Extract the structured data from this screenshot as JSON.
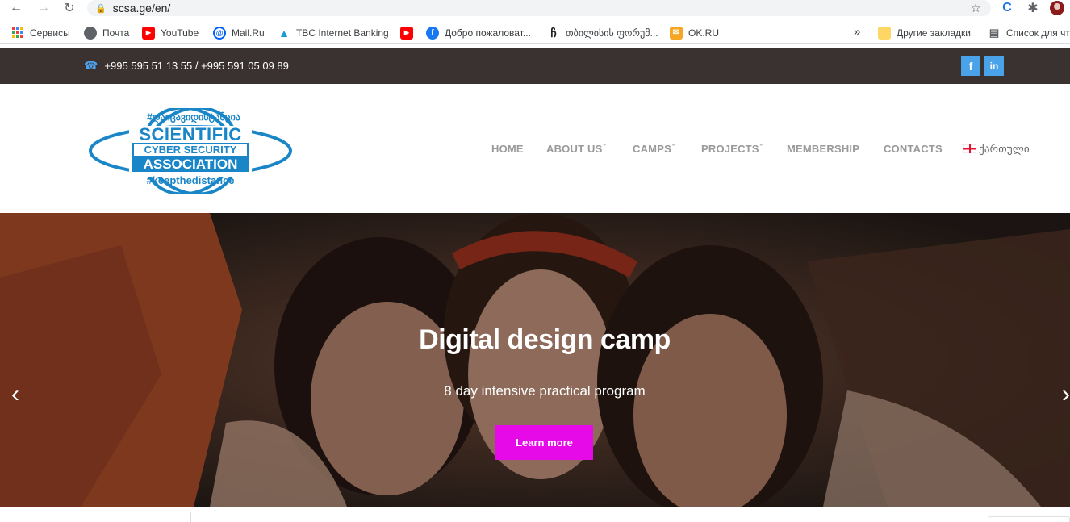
{
  "browser": {
    "url": "scsa.ge/en/",
    "bookmarks": [
      {
        "label": "Сервисы",
        "icon": "apps-grid-icon"
      },
      {
        "label": "Почта",
        "icon": "globe-icon"
      },
      {
        "label": "YouTube",
        "icon": "youtube-icon"
      },
      {
        "label": "Mail.Ru",
        "icon": "mailru-icon"
      },
      {
        "label": "TBC Internet Banking",
        "icon": "tbc-icon"
      },
      {
        "label": "",
        "icon": "youtube-icon"
      },
      {
        "label": "Добро пожаловат...",
        "icon": "facebook-icon"
      },
      {
        "label": "თბილისის ფორუმ...",
        "icon": "forum-icon"
      },
      {
        "label": "OK.RU",
        "icon": "mail-icon"
      }
    ],
    "other_bookmarks": "Другие закладки",
    "reading_list": "Список для чт"
  },
  "topbar": {
    "phone": "+995 595 51 13 55 / +995 591 05 09 89",
    "social": [
      "f",
      "in"
    ]
  },
  "logo": {
    "top_tag": "#დაიცავიდისტანცია",
    "line1": "SCIENTIFIC",
    "line2": "CYBER SECURITY",
    "line3": "ASSOCIATION",
    "bottom_tag": "#keepthedistance"
  },
  "menu": {
    "home": "HOME",
    "about": "ABOUT US",
    "camps": "CAMPS",
    "projects": "PROJECTS",
    "membership": "MEMBERSHIP",
    "contacts": "CONTACTS",
    "language": "ქართული"
  },
  "hero": {
    "title": "Digital design camp",
    "subtitle": "8 day intensive practical program",
    "button": "Learn more"
  },
  "colors": {
    "accent": "#e60ae8",
    "topbar": "#3a3230",
    "logo_blue": "#1a86c7",
    "social": "#4aa3e8"
  }
}
